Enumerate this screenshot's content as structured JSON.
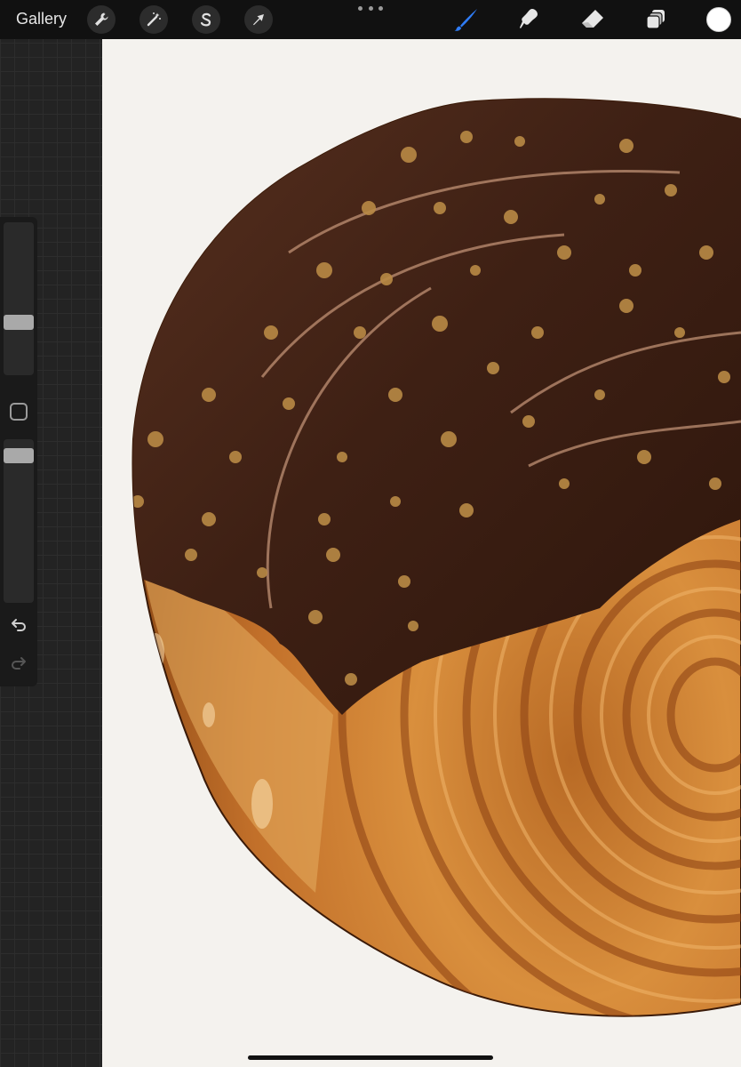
{
  "toolbar": {
    "gallery_label": "Gallery",
    "left_tools": [
      "wrench-icon",
      "magic-wand-icon",
      "selection-s-icon",
      "transform-arrow-icon"
    ],
    "right_tools": [
      "brush-icon",
      "smudge-icon",
      "eraser-icon",
      "layers-icon"
    ],
    "active_tool": "brush",
    "active_tool_color": "#2f7cf6",
    "current_color": "#ffffff"
  },
  "sidebar": {
    "brush_size": 0.32,
    "opacity": 0.96
  },
  "canvas": {
    "background": "#f4f2ee",
    "artwork": "chocolate-glazed-pastry-swirl"
  }
}
